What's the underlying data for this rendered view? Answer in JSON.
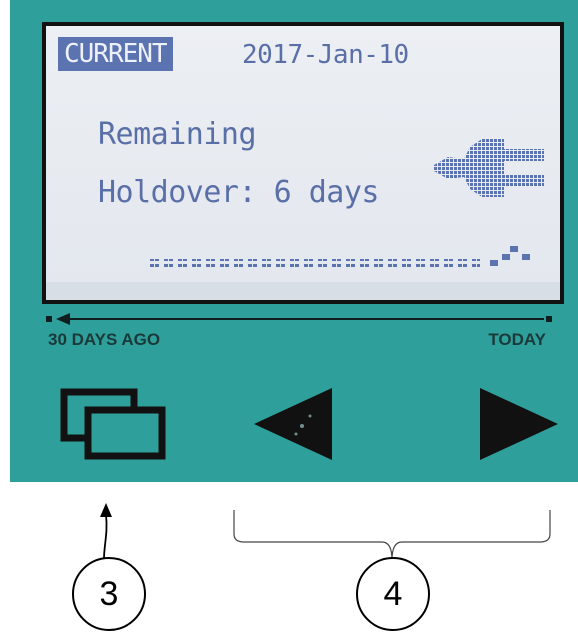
{
  "lcd": {
    "mode": "CURRENT",
    "date": "2017-Jan-10",
    "line1": "Remaining",
    "line2": "Holdover: 6 days",
    "text_color": "#5a6fa8"
  },
  "timeline": {
    "past_label": "30 DAYS AGO",
    "today_label": "TODAY"
  },
  "buttons": {
    "screens_icon": "overlapping-windows-icon",
    "prev_icon": "triangle-left-icon",
    "next_icon": "triangle-right-icon"
  },
  "callouts": {
    "c3": "3",
    "c4": "4"
  },
  "colors": {
    "panel": "#2f9f9b",
    "lcd_background": "#e6e9ef",
    "lcd_highlight": "#5b73b0"
  }
}
